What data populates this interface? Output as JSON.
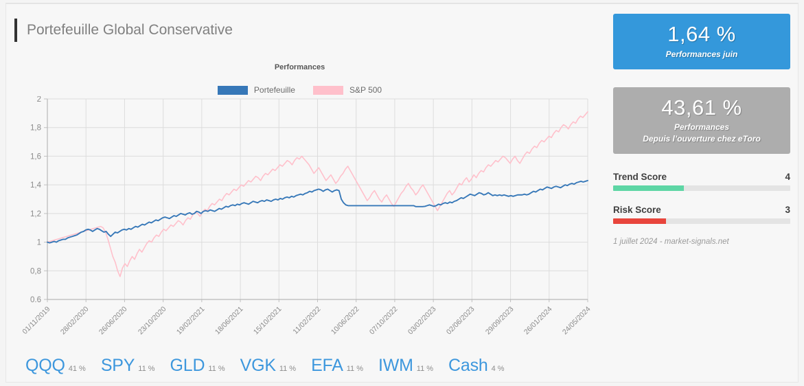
{
  "header": {
    "title": "Portefeuille Global Conservative"
  },
  "chart_data": {
    "type": "line",
    "title": "Performances",
    "xlabel": "",
    "ylabel": "",
    "grid": true,
    "legend_position": "top-center",
    "ylim": [
      0.6,
      2
    ],
    "yticks": [
      "0,6",
      "0,8",
      "1",
      "1,2",
      "1,4",
      "1,6",
      "1,8",
      "2"
    ],
    "ytick_values": [
      0.6,
      0.8,
      1.0,
      1.2,
      1.4,
      1.6,
      1.8,
      2.0
    ],
    "xticks": [
      "01/11/2019",
      "28/02/2020",
      "26/06/2020",
      "23/10/2020",
      "19/02/2021",
      "18/06/2021",
      "15/10/2021",
      "11/02/2022",
      "10/06/2022",
      "07/10/2022",
      "03/02/2023",
      "02/06/2023",
      "29/09/2023",
      "26/01/2024",
      "24/05/2024"
    ],
    "series": [
      {
        "name": "Portefeuille",
        "color": "#3778b8",
        "values": [
          1.0,
          0.995,
          1.0,
          1.005,
          1.0,
          1.01,
          1.015,
          1.02,
          1.02,
          1.03,
          1.035,
          1.04,
          1.045,
          1.05,
          1.06,
          1.07,
          1.075,
          1.085,
          1.09,
          1.085,
          1.075,
          1.085,
          1.095,
          1.09,
          1.08,
          1.07,
          1.075,
          1.055,
          1.04,
          1.055,
          1.07,
          1.065,
          1.075,
          1.085,
          1.09,
          1.085,
          1.095,
          1.09,
          1.1,
          1.11,
          1.105,
          1.115,
          1.125,
          1.12,
          1.13,
          1.14,
          1.135,
          1.145,
          1.155,
          1.15,
          1.16,
          1.17,
          1.175,
          1.17,
          1.165,
          1.175,
          1.185,
          1.18,
          1.19,
          1.2,
          1.195,
          1.19,
          1.2,
          1.205,
          1.195,
          1.2,
          1.215,
          1.21,
          1.2,
          1.215,
          1.22,
          1.215,
          1.225,
          1.22,
          1.215,
          1.225,
          1.235,
          1.23,
          1.24,
          1.25,
          1.245,
          1.255,
          1.26,
          1.255,
          1.265,
          1.26,
          1.27,
          1.275,
          1.27,
          1.265,
          1.275,
          1.285,
          1.28,
          1.275,
          1.285,
          1.29,
          1.285,
          1.295,
          1.29,
          1.285,
          1.295,
          1.3,
          1.295,
          1.305,
          1.3,
          1.31,
          1.315,
          1.31,
          1.32,
          1.315,
          1.325,
          1.33,
          1.335,
          1.33,
          1.34,
          1.345,
          1.355,
          1.35,
          1.36,
          1.365,
          1.37,
          1.365,
          1.355,
          1.365,
          1.37,
          1.36,
          1.35,
          1.36,
          1.365,
          1.36,
          1.3,
          1.275,
          1.26,
          1.255,
          1.255,
          1.255,
          1.255,
          1.255,
          1.255,
          1.255,
          1.255,
          1.255,
          1.255,
          1.255,
          1.255,
          1.255,
          1.255,
          1.255,
          1.255,
          1.255,
          1.255,
          1.255,
          1.255,
          1.255,
          1.255,
          1.255,
          1.255,
          1.255,
          1.255,
          1.255,
          1.255,
          1.255,
          1.255,
          1.248,
          1.248,
          1.248,
          1.248,
          1.25,
          1.255,
          1.26,
          1.255,
          1.25,
          1.255,
          1.265,
          1.26,
          1.27,
          1.275,
          1.27,
          1.28,
          1.275,
          1.285,
          1.29,
          1.3,
          1.31,
          1.305,
          1.315,
          1.325,
          1.335,
          1.33,
          1.325,
          1.335,
          1.345,
          1.34,
          1.33,
          1.335,
          1.345,
          1.335,
          1.325,
          1.33,
          1.325,
          1.33,
          1.325,
          1.33,
          1.325,
          1.32,
          1.325,
          1.32,
          1.325,
          1.33,
          1.33,
          1.33,
          1.335,
          1.33,
          1.335,
          1.345,
          1.355,
          1.35,
          1.36,
          1.37,
          1.365,
          1.375,
          1.385,
          1.38,
          1.375,
          1.385,
          1.39,
          1.385,
          1.38,
          1.39,
          1.4,
          1.395,
          1.405,
          1.41,
          1.405,
          1.415,
          1.42,
          1.425,
          1.42,
          1.425,
          1.43
        ]
      },
      {
        "name": "S&P 500",
        "color": "#ffc0cb",
        "values": [
          1.0,
          1.005,
          1.01,
          1.015,
          1.02,
          1.025,
          1.03,
          1.035,
          1.04,
          1.045,
          1.05,
          1.055,
          1.06,
          1.065,
          1.07,
          1.075,
          1.08,
          1.085,
          1.09,
          1.095,
          1.1,
          1.105,
          1.11,
          1.1,
          1.07,
          1.02,
          0.96,
          0.9,
          0.86,
          0.8,
          0.76,
          0.82,
          0.85,
          0.83,
          0.87,
          0.9,
          0.88,
          0.92,
          0.95,
          0.93,
          0.96,
          0.99,
          1.01,
          1.0,
          1.03,
          1.05,
          1.04,
          1.07,
          1.09,
          1.08,
          1.1,
          1.12,
          1.11,
          1.13,
          1.15,
          1.14,
          1.12,
          1.15,
          1.17,
          1.16,
          1.19,
          1.21,
          1.2,
          1.18,
          1.21,
          1.23,
          1.22,
          1.25,
          1.27,
          1.26,
          1.28,
          1.3,
          1.29,
          1.32,
          1.34,
          1.33,
          1.35,
          1.37,
          1.36,
          1.38,
          1.4,
          1.39,
          1.41,
          1.43,
          1.42,
          1.44,
          1.46,
          1.45,
          1.43,
          1.46,
          1.48,
          1.47,
          1.49,
          1.51,
          1.5,
          1.52,
          1.54,
          1.53,
          1.55,
          1.57,
          1.56,
          1.54,
          1.57,
          1.59,
          1.58,
          1.6,
          1.58,
          1.56,
          1.54,
          1.51,
          1.48,
          1.5,
          1.52,
          1.49,
          1.46,
          1.43,
          1.45,
          1.47,
          1.44,
          1.41,
          1.43,
          1.46,
          1.48,
          1.51,
          1.53,
          1.5,
          1.47,
          1.44,
          1.41,
          1.38,
          1.35,
          1.32,
          1.29,
          1.31,
          1.34,
          1.36,
          1.33,
          1.3,
          1.28,
          1.31,
          1.33,
          1.3,
          1.27,
          1.25,
          1.28,
          1.31,
          1.34,
          1.36,
          1.39,
          1.41,
          1.38,
          1.36,
          1.33,
          1.35,
          1.38,
          1.4,
          1.37,
          1.34,
          1.31,
          1.28,
          1.25,
          1.22,
          1.25,
          1.28,
          1.31,
          1.34,
          1.36,
          1.33,
          1.35,
          1.38,
          1.41,
          1.4,
          1.43,
          1.45,
          1.42,
          1.44,
          1.47,
          1.45,
          1.48,
          1.5,
          1.49,
          1.52,
          1.54,
          1.53,
          1.55,
          1.57,
          1.56,
          1.58,
          1.6,
          1.59,
          1.57,
          1.55,
          1.58,
          1.6,
          1.57,
          1.55,
          1.58,
          1.61,
          1.63,
          1.62,
          1.65,
          1.67,
          1.66,
          1.69,
          1.71,
          1.7,
          1.72,
          1.74,
          1.73,
          1.76,
          1.78,
          1.77,
          1.8,
          1.82,
          1.81,
          1.79,
          1.82,
          1.84,
          1.83,
          1.86,
          1.88,
          1.87,
          1.89,
          1.91
        ]
      }
    ]
  },
  "holdings": [
    {
      "ticker": "QQQ",
      "weight": "41 %"
    },
    {
      "ticker": "SPY",
      "weight": "11 %"
    },
    {
      "ticker": "GLD",
      "weight": "11 %"
    },
    {
      "ticker": "VGK",
      "weight": "11 %"
    },
    {
      "ticker": "EFA",
      "weight": "11 %"
    },
    {
      "ticker": "IWM",
      "weight": "11 %"
    },
    {
      "ticker": "Cash",
      "weight": "4 %"
    }
  ],
  "kpis": [
    {
      "value": "1,64 %",
      "sub_line1": "Performances juin",
      "sub_line2": "",
      "color": "#3498db"
    },
    {
      "value": "43,61 %",
      "sub_line1": "Performances",
      "sub_line2": "Depuis l’ouverture chez eToro",
      "color": "#adadad"
    }
  ],
  "scores": [
    {
      "label": "Trend Score",
      "value": "4",
      "percent": 40,
      "color": "#5ed6a5"
    },
    {
      "label": "Risk Score",
      "value": "3",
      "percent": 30,
      "color": "#e8453c"
    }
  ],
  "footnote": "1 juillet 2024 - market-signals.net",
  "colors": {
    "background": "#f7f7f7",
    "portfolio_line": "#3778b8",
    "benchmark_line": "#ffc0cb",
    "ticker_text": "#3d97dd",
    "accent_blue": "#3498db"
  }
}
